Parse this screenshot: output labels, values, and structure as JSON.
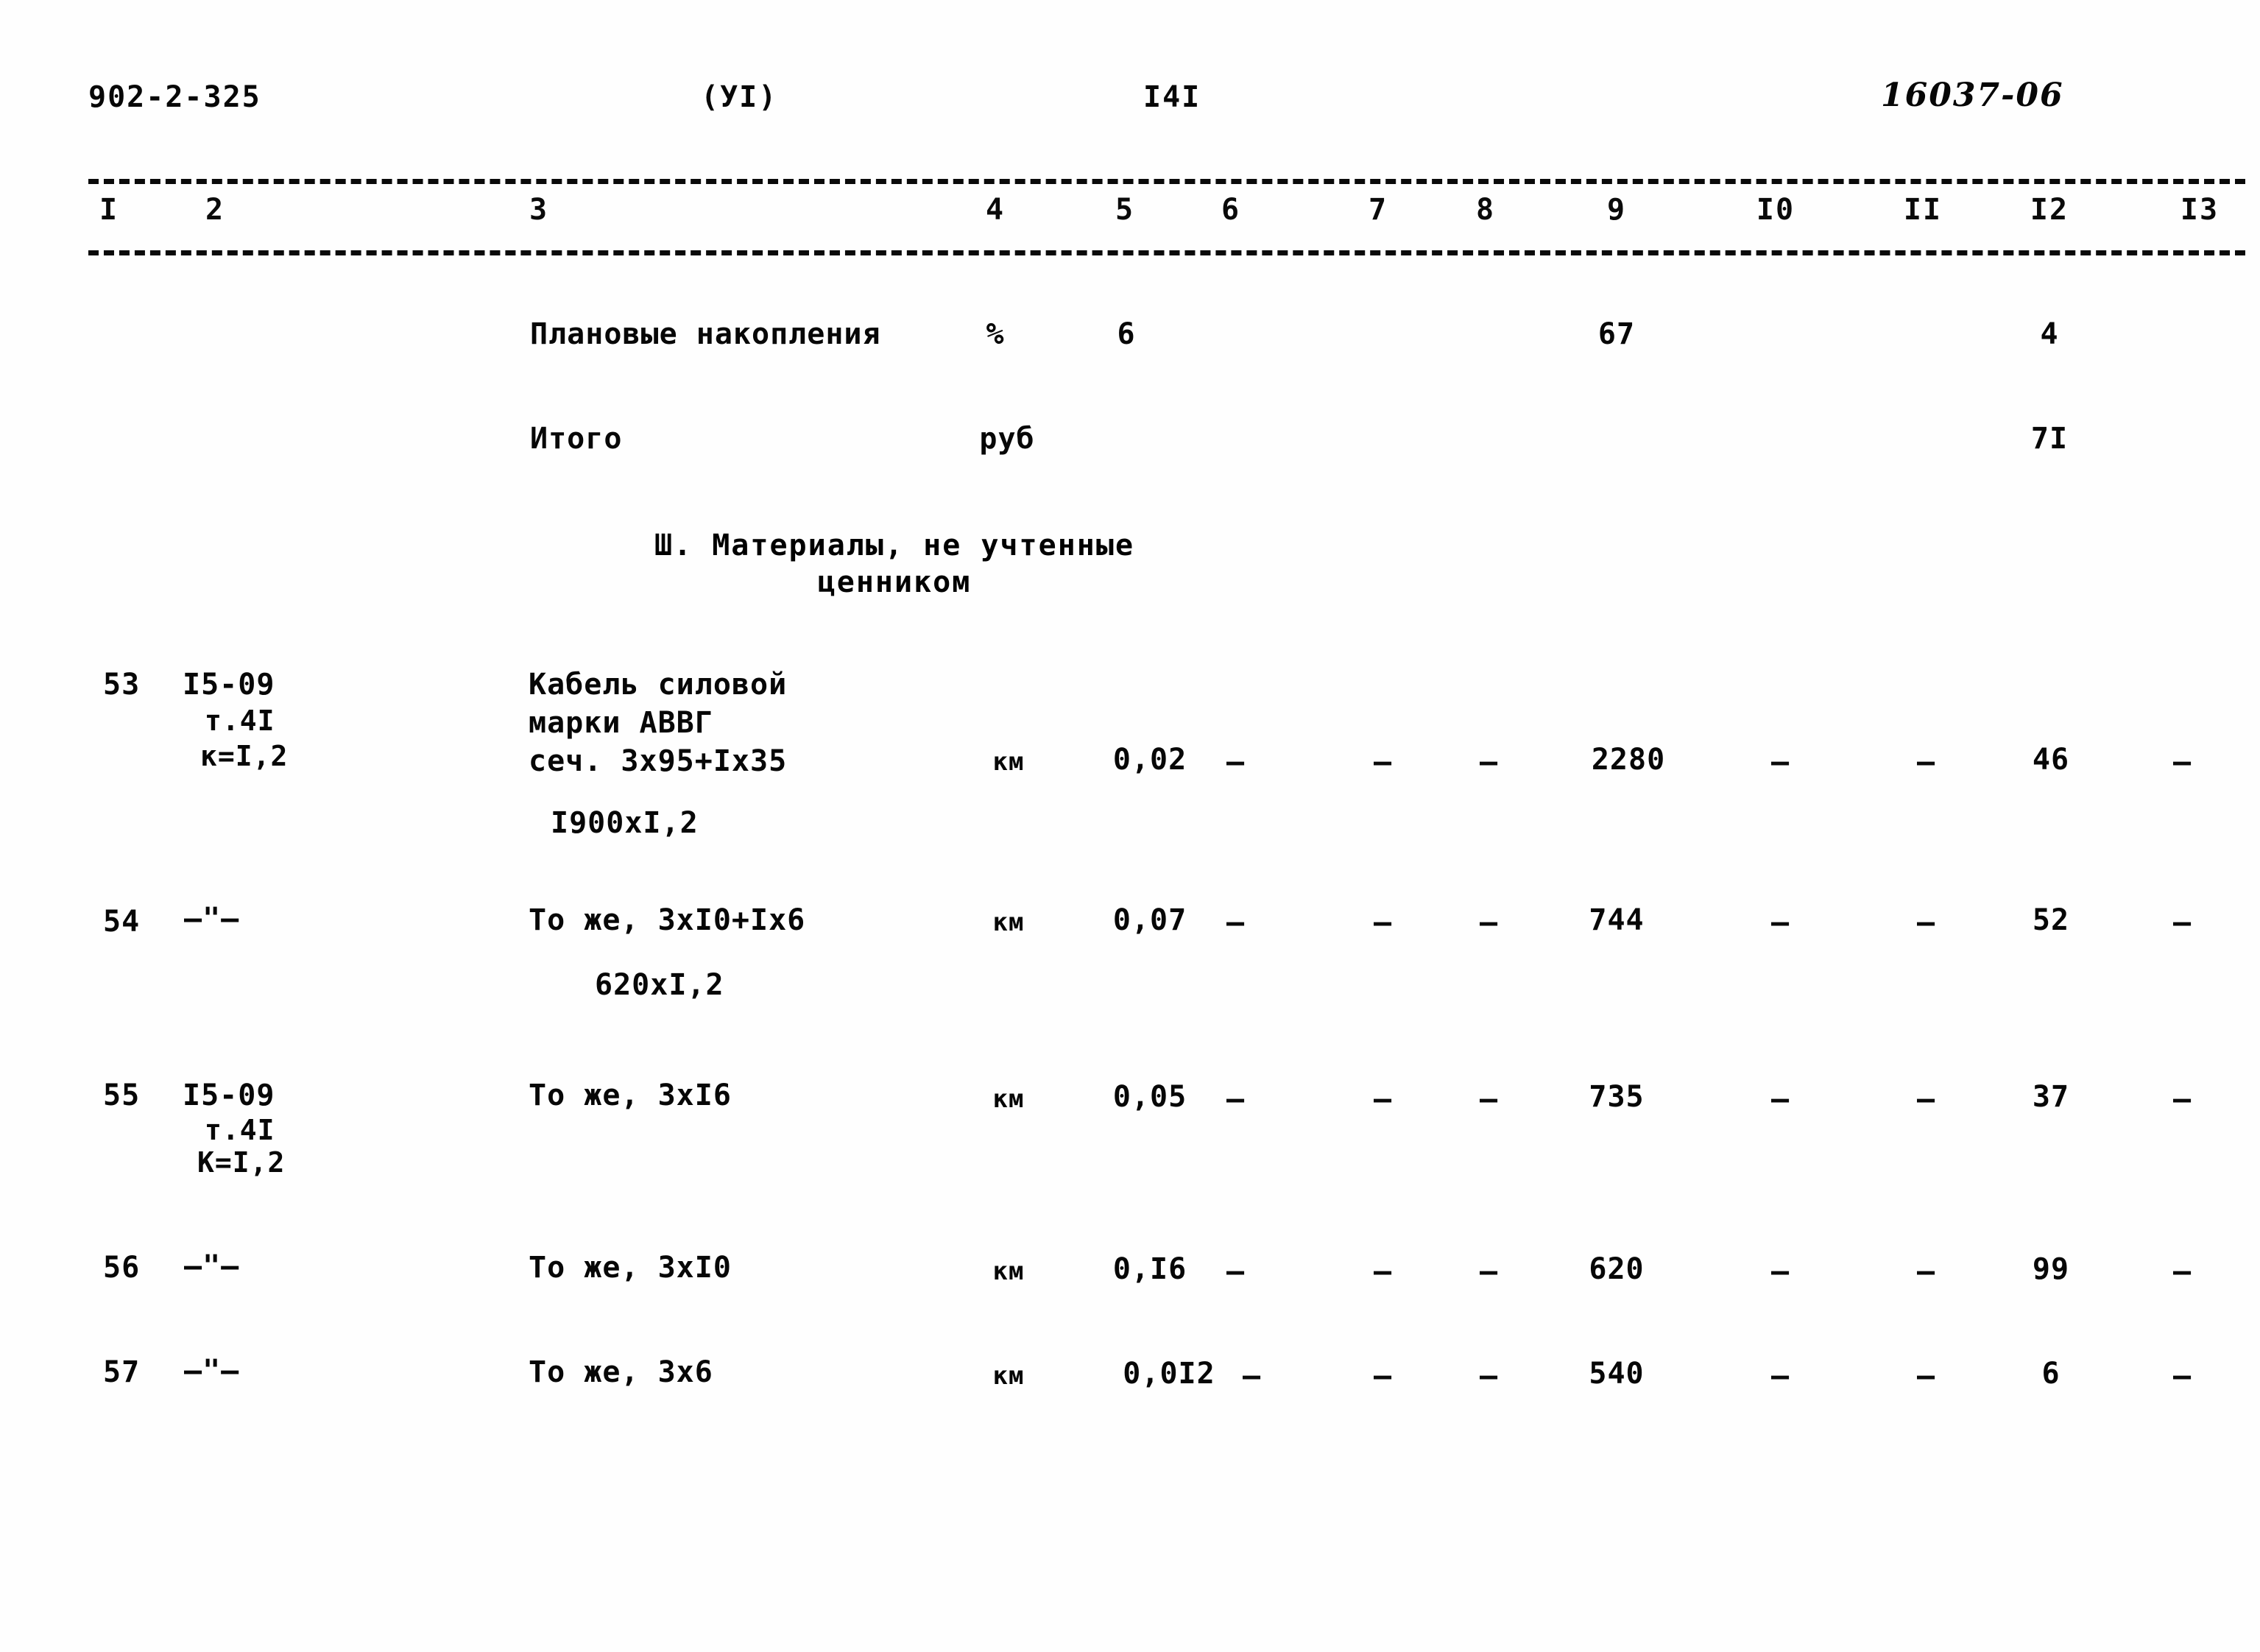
{
  "header": {
    "doc_code": "902-2-325",
    "part_marker": "(УI)",
    "page_number": "I4I",
    "stamp": "16037-06"
  },
  "table": {
    "column_numbers": [
      "I",
      "2",
      "3",
      "4",
      "5",
      "6",
      "7",
      "8",
      "9",
      "I0",
      "II",
      "I2",
      "I3"
    ],
    "summary_rows": [
      {
        "name": "Плановые накопления",
        "unit": "%",
        "col5": "6",
        "col9": "67",
        "col12": "4"
      },
      {
        "name": "Итого",
        "unit": "руб",
        "col5": "",
        "col9": "",
        "col12": "7I"
      }
    ],
    "section_title_line1": "Ш. Материалы, не учтенные",
    "section_title_line2": "ценником",
    "rows": [
      {
        "num": "53",
        "code_l1": "I5-09",
        "code_l2": "т.4I",
        "code_l3": "к=I,2",
        "name_l1": "Кабель силовой",
        "name_l2": "марки АВВГ",
        "name_l3": "сеч. 3x95+Ix35",
        "name_l4": "I900xI,2",
        "unit": "км",
        "c5": "0,02",
        "c6": "–",
        "c7": "–",
        "c8": "–",
        "c9": "2280",
        "c10": "–",
        "c11": "–",
        "c12": "46",
        "c13": "–"
      },
      {
        "num": "54",
        "code_l1": "–\"–",
        "code_l2": "",
        "code_l3": "",
        "name_l1": "То же, 3xI0+Ix6",
        "name_l2": "",
        "name_l3": "",
        "name_l4": "620xI,2",
        "unit": "км",
        "c5": "0,07",
        "c6": "–",
        "c7": "–",
        "c8": "–",
        "c9": "744",
        "c10": "–",
        "c11": "–",
        "c12": "52",
        "c13": "–"
      },
      {
        "num": "55",
        "code_l1": "I5-09",
        "code_l2": "т.4I",
        "code_l3": "К=I,2",
        "name_l1": "То же, 3xI6",
        "name_l2": "",
        "name_l3": "",
        "name_l4": "",
        "unit": "км",
        "c5": "0,05",
        "c6": "–",
        "c7": "–",
        "c8": "–",
        "c9": "735",
        "c10": "–",
        "c11": "–",
        "c12": "37",
        "c13": "–"
      },
      {
        "num": "56",
        "code_l1": "–\"–",
        "code_l2": "",
        "code_l3": "",
        "name_l1": "То же, 3xI0",
        "name_l2": "",
        "name_l3": "",
        "name_l4": "",
        "unit": "км",
        "c5": "0,I6",
        "c6": "–",
        "c7": "–",
        "c8": "–",
        "c9": "620",
        "c10": "–",
        "c11": "–",
        "c12": "99",
        "c13": "–"
      },
      {
        "num": "57",
        "code_l1": "–\"–",
        "code_l2": "",
        "code_l3": "",
        "name_l1": "То же, 3x6",
        "name_l2": "",
        "name_l3": "",
        "name_l4": "",
        "unit": "км",
        "c5": "0,0I2",
        "c6": "–",
        "c7": "–",
        "c8": "–",
        "c9": "540",
        "c10": "–",
        "c11": "–",
        "c12": "6",
        "c13": "–"
      }
    ]
  }
}
